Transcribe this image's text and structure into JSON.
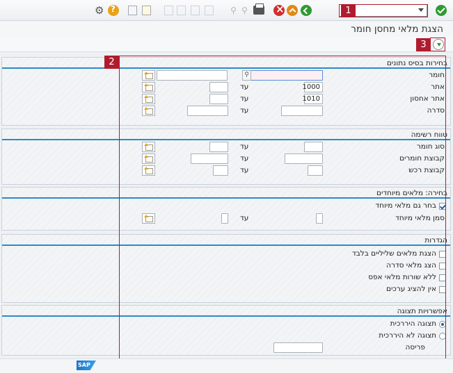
{
  "toolbar": {
    "icons": [
      "ok-icon",
      "command-field",
      "back-icon",
      "exit-icon",
      "cancel-icon",
      "print-icon",
      "find-icon",
      "find-next-icon",
      "first-page-icon",
      "previous-page-icon",
      "next-page-icon",
      "last-page-icon",
      "new-session-icon",
      "create-shortcut-icon",
      "help-icon",
      "customize-layout-icon"
    ],
    "command_value": ""
  },
  "title": "הצגת מלאי מחסן חומר",
  "annotations": {
    "one": "1",
    "two": "2",
    "three": "3"
  },
  "groups": {
    "db": {
      "title": "בחירות בסיס נתונים",
      "material_label": "חומר",
      "plant_label": "אתר",
      "plant_from": "1000",
      "sloc_label": "אתר אחסון",
      "sloc_from": "1010",
      "batch_label": "סדרה",
      "to_label": "עד"
    },
    "range": {
      "title": "טווח רשימה",
      "mat_type_label": "סוג חומר",
      "mat_group_label": "קבוצת חומרים",
      "pur_group_label": "קבוצת רכש",
      "to_label": "עד"
    },
    "special": {
      "title": "בחירה: מלאים מיוחדים",
      "also_special_label": "בחר גם מלאי מיוחד",
      "special_ind_label": "סמן מלאי מיוחד",
      "to_label": "עד"
    },
    "settings": {
      "title": "הגדרות",
      "neg_only": "הצגת מלאים שליליים בלבד",
      "batch_stock": "הצג מלאי סדרה",
      "no_zero": "ללא שורות מלאי אפס",
      "no_values": "אין להציג ערכים"
    },
    "display": {
      "title": "אפשרויות תצוגה",
      "hier": "תצוגה היררכית",
      "nonhier": "תצוגה לא היררכית",
      "layout_label": "פריסה"
    }
  },
  "footer": {
    "logo": "SAP"
  }
}
